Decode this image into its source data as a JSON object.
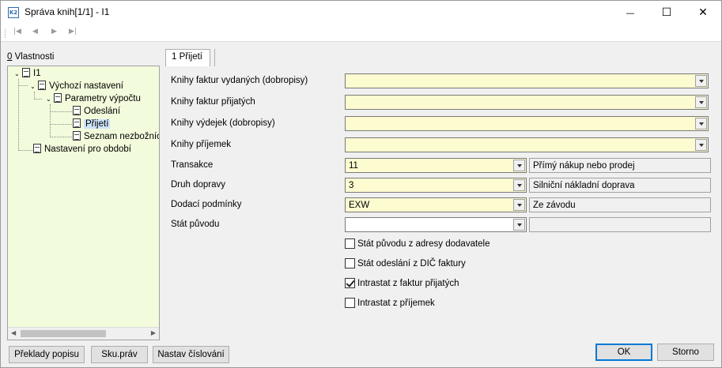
{
  "window": {
    "title": "Správa knih[1/1] - I1",
    "app_icon_text": "K2",
    "minimize_glyph": "—",
    "maximize_glyph": "☐",
    "close_glyph": "✕"
  },
  "toolbar": {
    "first_glyph": "|◀",
    "prev_glyph": "◀",
    "next_glyph": "▶",
    "last_glyph": "▶|"
  },
  "left_panel": {
    "label_underlined": "0",
    "label_rest": " Vlastnosti",
    "tree": [
      {
        "label": "I1",
        "level": 0,
        "expanded": true
      },
      {
        "label": "Výchozí nastavení",
        "level": 1,
        "expanded": true
      },
      {
        "label": "Parametry výpočtu",
        "level": 2,
        "expanded": true
      },
      {
        "label": "Odeslání",
        "level": 3
      },
      {
        "label": "Přijetí",
        "level": 3,
        "selected": true
      },
      {
        "label": "Seznam nezbožních",
        "level": 3
      },
      {
        "label": "Nastavení pro období",
        "level": 1
      }
    ]
  },
  "tabs": [
    {
      "label": "1 Přijetí",
      "active": true
    }
  ],
  "form": {
    "fields": [
      {
        "label": "Knihy faktur vydaných (dobropisy)",
        "value": ""
      },
      {
        "label": "Knihy faktur přijatých",
        "value": ""
      },
      {
        "label": "Knihy výdejek (dobropisy)",
        "value": ""
      },
      {
        "label": "Knihy příjemek",
        "value": ""
      },
      {
        "label": "Transakce",
        "value": "11",
        "description": "Přímý nákup nebo prodej"
      },
      {
        "label": "Druh dopravy",
        "value": "3",
        "description": "Silniční nákladní doprava"
      },
      {
        "label": "Dodací podmínky",
        "value": "EXW",
        "description": "Ze závodu"
      },
      {
        "label": "Stát původu",
        "value": "",
        "description": ""
      }
    ],
    "checkboxes": [
      {
        "label": "Stát původu z adresy dodavatele",
        "checked": false
      },
      {
        "label": "Stát odeslání z DIČ faktury",
        "checked": false
      },
      {
        "label": "Intrastat z faktur přijatých",
        "checked": true
      },
      {
        "label": "Intrastat z příjemek",
        "checked": false
      }
    ]
  },
  "footer": {
    "translate_label": "Překlady popisu",
    "sku_label": "Sku.práv",
    "numbering_label": "Nastav číslování",
    "ok_label": "OK",
    "cancel_label": "Storno"
  },
  "colors": {
    "tree_background": "#f2fbdc",
    "field_background": "#fdfbd0",
    "selection": "#cce4f7",
    "default_button_border": "#0078d7"
  }
}
